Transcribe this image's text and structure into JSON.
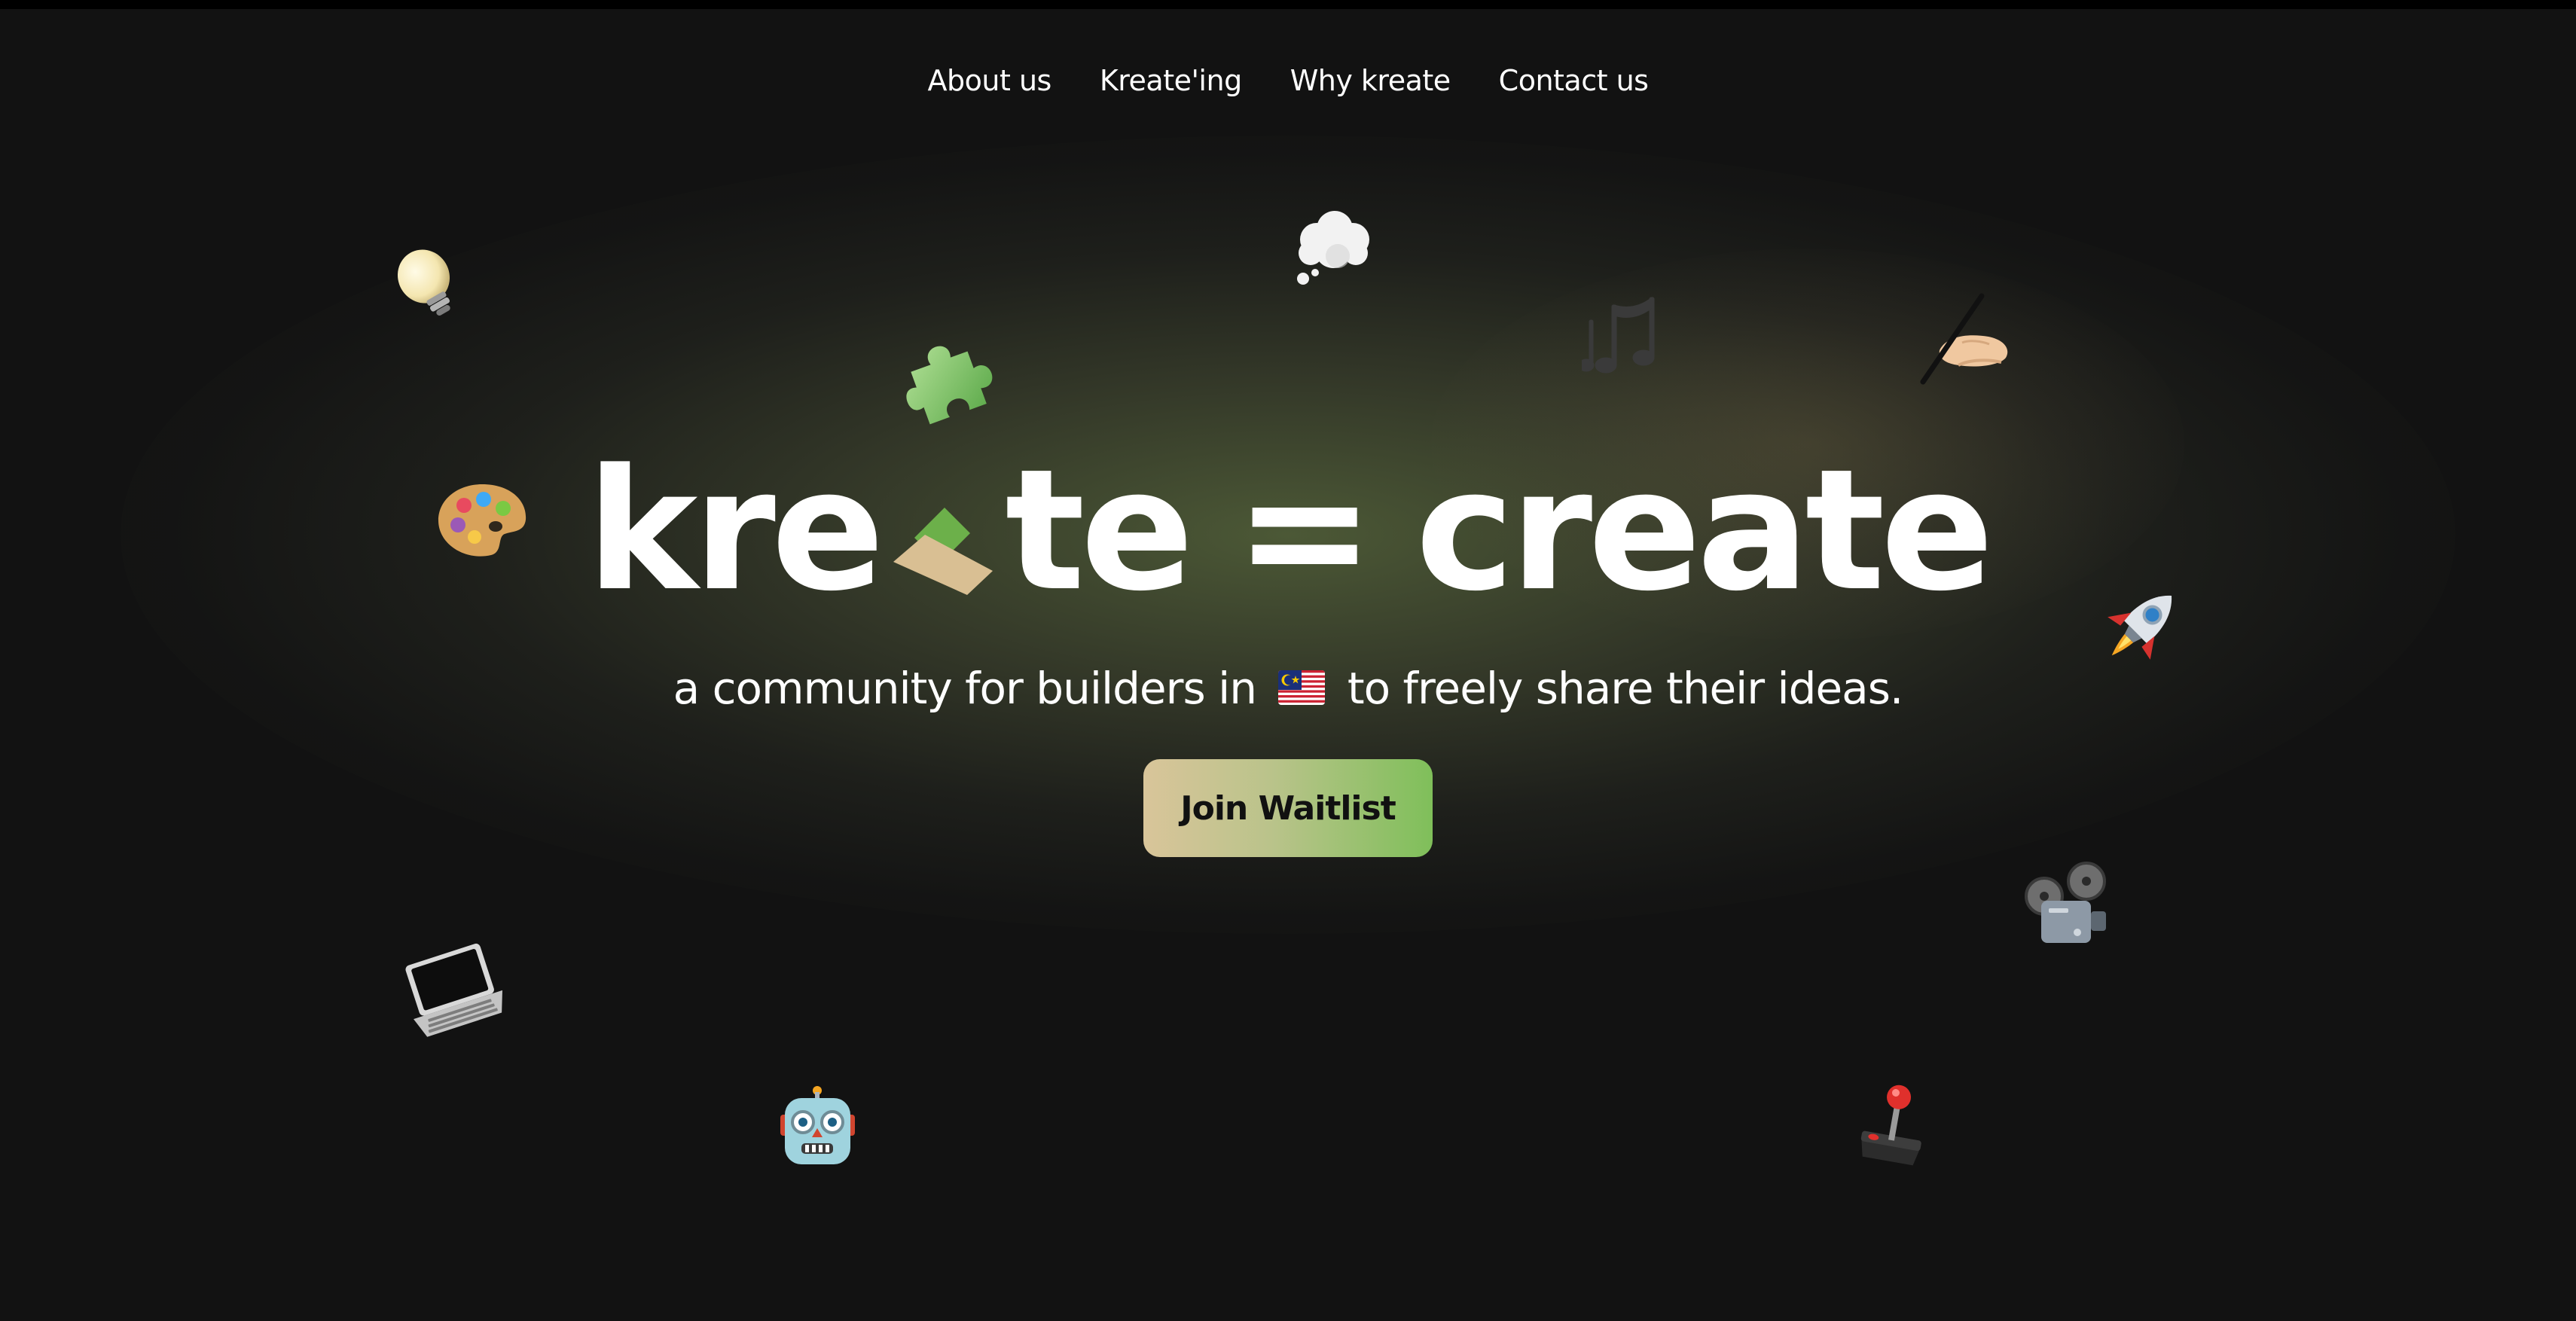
{
  "nav": {
    "items": [
      {
        "label": "About us"
      },
      {
        "label": "Kreate'ing"
      },
      {
        "label": "Why kreate"
      },
      {
        "label": "Contact us"
      }
    ]
  },
  "hero": {
    "title_part1": "kre",
    "title_part2": "te",
    "title_equals": "=",
    "title_part3": "create",
    "subtitle_before": "a community for builders in",
    "subtitle_after": "to freely share their ideas.",
    "flag_icon": "malaysia-flag-icon",
    "cta_label": "Join Waitlist"
  },
  "decor_icons": [
    "lightbulb-icon",
    "thought-bubble-icon",
    "puzzle-piece-icon",
    "music-notes-icon",
    "writing-hand-icon",
    "artist-palette-icon",
    "rocket-icon",
    "film-projector-icon",
    "laptop-icon",
    "robot-icon",
    "joystick-icon"
  ],
  "colors": {
    "background": "#121212",
    "text": "#ffffff",
    "cta_gradient_start": "#d9c59a",
    "cta_gradient_end": "#7fbf5a",
    "logo_green": "#6cb04a",
    "logo_tan": "#d9bf93"
  }
}
